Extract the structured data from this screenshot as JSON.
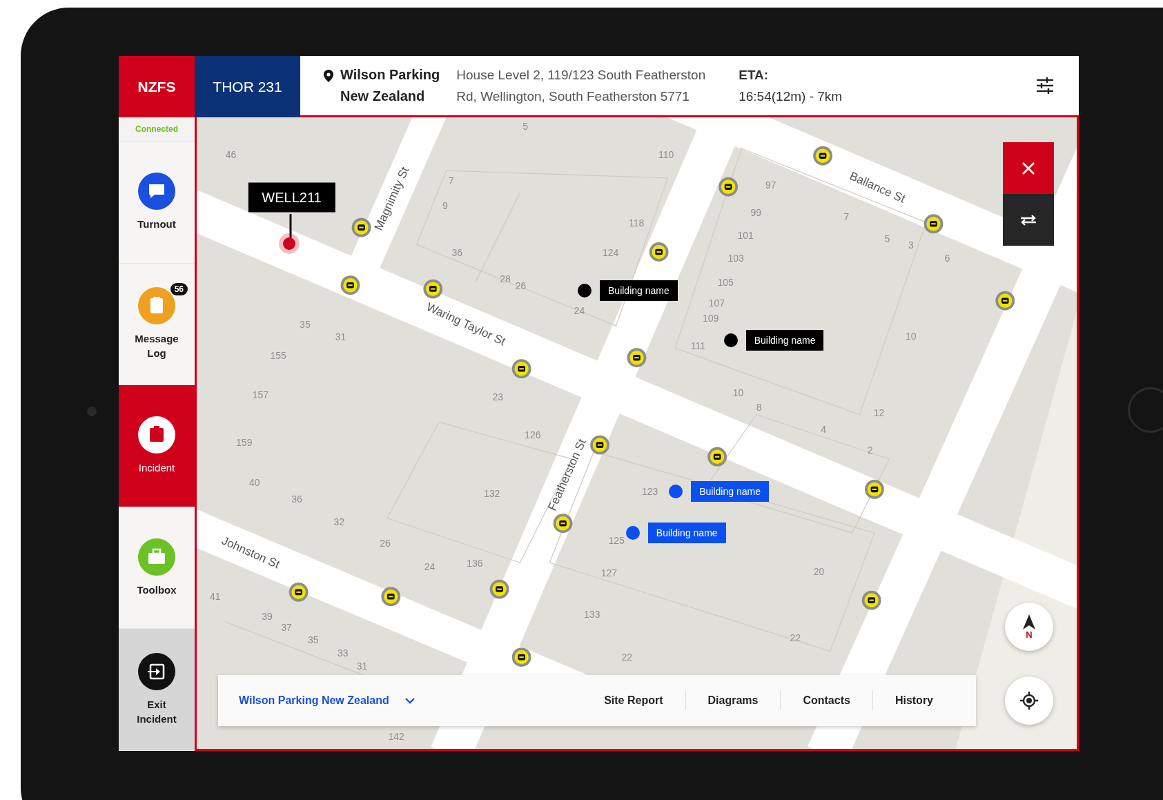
{
  "header": {
    "brand": "NZFS",
    "unit": "THOR 231",
    "site_name": [
      "Wilson Parking",
      "New Zealand"
    ],
    "address": [
      "House Level 2, 119/123 South Featherston",
      "Rd, Wellington, South Featherston 5771"
    ],
    "eta_label": "ETA:",
    "eta_value": "16:54(12m) - 7km"
  },
  "sidebar": {
    "status": "Connected",
    "items": [
      {
        "label": "Turnout",
        "kind": "nav",
        "color": "#1a4fe0",
        "selected": false
      },
      {
        "label": "Message Log",
        "kind": "nav",
        "color": "#f0a020",
        "selected": false,
        "badge": "56"
      },
      {
        "label": "Incident",
        "kind": "nav",
        "color": "#d0021b",
        "selected": true
      },
      {
        "label": "Toolbox",
        "kind": "nav",
        "color": "#6cc224",
        "selected": false
      },
      {
        "label": "Exit Incident",
        "kind": "exit",
        "color": "#111111",
        "selected": false
      }
    ]
  },
  "map": {
    "callout": "WELL211",
    "streets": [
      "Magnimity St",
      "Waring Taylor St",
      "Ballance St",
      "Featherston St",
      "Johnston St"
    ],
    "house_numbers": [
      "46",
      "5",
      "110",
      "7",
      "9",
      "118",
      "36",
      "124",
      "28",
      "26",
      "24",
      "35",
      "31",
      "155",
      "157",
      "23",
      "126",
      "159",
      "97",
      "99",
      "101",
      "103",
      "105",
      "107",
      "109",
      "111",
      "7",
      "5",
      "3",
      "6",
      "10",
      "10",
      "8",
      "12",
      "4",
      "2",
      "40",
      "36",
      "32",
      "26",
      "132",
      "24",
      "136",
      "123",
      "125",
      "127",
      "20",
      "133",
      "22",
      "22",
      "41",
      "39",
      "37",
      "35",
      "33",
      "31",
      "142"
    ],
    "buildings": [
      {
        "label": "Building name",
        "color": "#000000"
      },
      {
        "label": "Building name",
        "color": "#000000"
      },
      {
        "label": "Building name",
        "color": "#0a4ff0"
      },
      {
        "label": "Building name",
        "color": "#0a4ff0"
      }
    ],
    "compass_label": "N"
  },
  "bottom_bar": {
    "site": "Wilson Parking New Zealand",
    "tabs": [
      "Site Report",
      "Diagrams",
      "Contacts",
      "History"
    ]
  }
}
